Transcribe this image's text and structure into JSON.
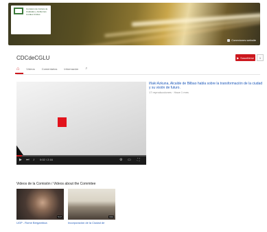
{
  "banner": {
    "logo_text": "Comisión de Cultura de Ciudades y Gobiernos Locales Unidos",
    "links_label": "Conexiones website"
  },
  "channel": {
    "name": "CDCdeCGLU",
    "subscribe_label": "Suscribirse",
    "subscriber_count": "1"
  },
  "tabs": [
    {
      "label": "Inicio"
    },
    {
      "label": "Vídeos"
    },
    {
      "label": "Comentarios"
    },
    {
      "label": "Información"
    }
  ],
  "player": {
    "time": "0:02 / 2:16",
    "progress": 0.04
  },
  "featured_video": {
    "title": "Iñaki Azkuna, Alcalde de Bilbao habla sobre la transformación de la ciudad y su visión de futuro.",
    "meta": "17 reproducciones · Hace 1 mes"
  },
  "section": {
    "title": "Videos de la Comisión / Videos about the Commitee"
  },
  "videos": [
    {
      "title": "UGP - Rome Bergamboa",
      "duration": "5:17"
    },
    {
      "title": "Incorporación de la Ciudad de",
      "duration": "3:01"
    }
  ],
  "colors": {
    "brand_red": "#cc181e",
    "link_blue": "#1a56b8"
  }
}
